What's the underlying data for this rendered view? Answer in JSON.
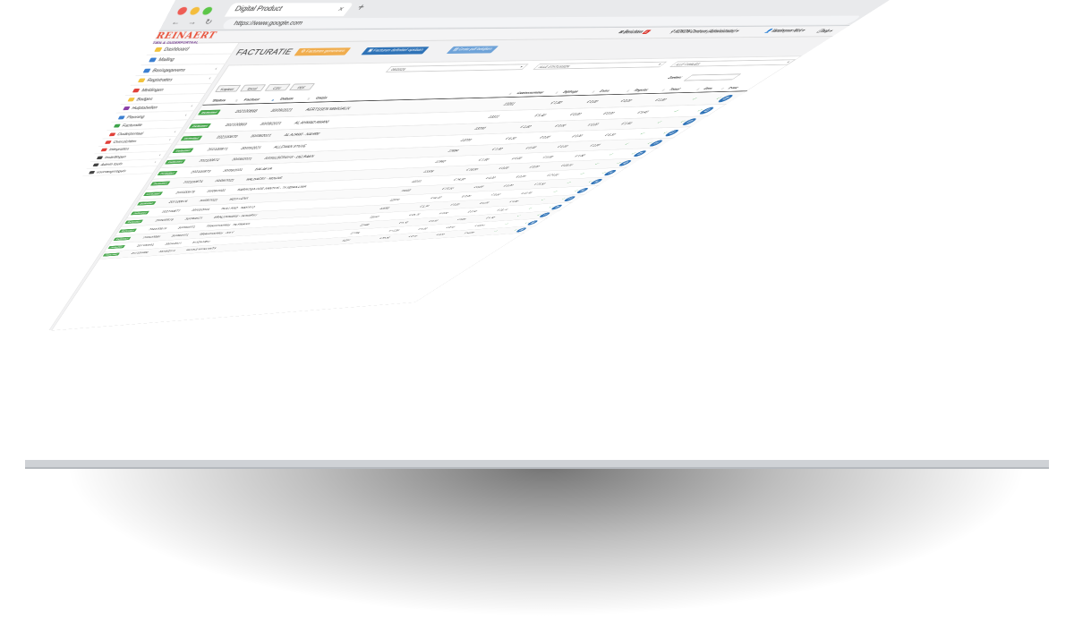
{
  "browser": {
    "tab_title": "Digital Product",
    "tab_close": "×",
    "new_tab": "+",
    "url": "https://www.google.com"
  },
  "logo": {
    "name": "REINAERT",
    "tagline": "TIEN & OUDERPORTAAL"
  },
  "topbar": {
    "messages_label": "Berichten",
    "messages_count": "0",
    "center_label": "KOKON-Centrum (Administrator) ▾",
    "user_label": "Vandevyver Nick ▾",
    "help_label": "help ▾"
  },
  "sidebar": {
    "items": [
      {
        "label": "Dashboard",
        "color": "#f2c33c",
        "chevron": ""
      },
      {
        "label": "Mailing",
        "color": "#3b7fd1",
        "chevron": ""
      },
      {
        "label": "Basisgegevens",
        "color": "#3b7fd1",
        "chevron": "‹"
      },
      {
        "label": "Registraties",
        "color": "#f2c33c",
        "chevron": "‹"
      },
      {
        "label": "Meldingen",
        "color": "#e0413a",
        "chevron": ""
      },
      {
        "label": "Badges",
        "color": "#f2c33c",
        "chevron": ""
      },
      {
        "label": "Hulptabellen",
        "color": "#8b3fa8",
        "chevron": "‹"
      },
      {
        "label": "Planning",
        "color": "#3b7fd1",
        "chevron": "‹"
      },
      {
        "label": "Facturatie",
        "color": "#3da34a",
        "chevron": ""
      },
      {
        "label": "Ouderportaal",
        "color": "#e0413a",
        "chevron": "‹"
      },
      {
        "label": "Overzichten",
        "color": "#e0413a",
        "chevron": "‹"
      },
      {
        "label": "Integraties",
        "color": "#e0413a",
        "chevron": ""
      },
      {
        "label": "Instellingen",
        "color": "#444444",
        "chevron": "‹"
      },
      {
        "label": "Admin tools",
        "color": "#444444",
        "chevron": "‹"
      },
      {
        "label": "voorrangsregels",
        "color": "#444444",
        "chevron": ""
      }
    ]
  },
  "page": {
    "title": "FACTURATIE",
    "btn_generate": "Facturen genereren",
    "btn_save": "Facturen definitief opslaan",
    "btn_pdf": "Grote pdf bekijken",
    "filter_period": "09/2025",
    "filter_status": "ALLE STATUSSEN",
    "filter_family": "ALLE FAMILIES",
    "export_buttons": [
      "Kopieer",
      "Excel",
      "CSV",
      "PDF"
    ],
    "search_label": "Zoeken:",
    "columns": [
      "Status",
      "Factuur",
      "Datum",
      "Gezin",
      "Gezinsnummer",
      "Bijdrage",
      "Extra",
      "Regular.",
      "Totaal",
      "Dom.",
      "E-Fac"
    ],
    "rows": [
      {
        "status": "Definitief",
        "factuur": "202100868",
        "datum": "30/09/2021",
        "gezin": "AERTSSEN MARGAUX",
        "nr": "13261",
        "bijdrage": "€ 1,80",
        "extra": "€ 0,00",
        "regular": "€ 0,00",
        "totaal": "€ 1,80"
      },
      {
        "status": "Definitief",
        "factuur": "202100869",
        "datum": "30/09/2021",
        "gezin": "AL AHMAD AMANI",
        "nr": "13311",
        "bijdrage": "€ 5,40",
        "extra": "€ 0,00",
        "regular": "€ 0,00",
        "totaal": "€ 5,40"
      },
      {
        "status": "Definitief",
        "factuur": "202100870",
        "datum": "30/09/2021",
        "gezin": "AL AZAWI - NAHRE",
        "nr": "13200",
        "bijdrage": "€ 1,80",
        "extra": "€ 0,00",
        "regular": "€ 0,00",
        "totaal": "€ 1,80"
      },
      {
        "status": "Definitief",
        "factuur": "202100871",
        "datum": "30/09/2021",
        "gezin": "ALLEMAN STEVE",
        "nr": "13299",
        "bijdrage": "€ 6,30",
        "extra": "€ 0,00",
        "regular": "€ 0,00",
        "totaal": "€ 6,30"
      },
      {
        "status": "Definitief",
        "factuur": "202100872",
        "datum": "30/09/2021",
        "gezin": "ASSELBERGHS - DELBAEN",
        "nr": "12884",
        "bijdrage": "€ 1,80",
        "extra": "€ 0,00",
        "regular": "€ 0,00",
        "totaal": "€ 1,80"
      },
      {
        "status": "Definitief",
        "factuur": "202100873",
        "datum": "30/09/2021",
        "gezin": "BALAEVA",
        "nr": "12860",
        "bijdrage": "€ 1,80",
        "extra": "€ 0,00",
        "regular": "€ 0,00",
        "totaal": "€ 1,80"
      },
      {
        "status": "Definitief",
        "factuur": "202100874",
        "datum": "30/09/2021",
        "gezin": "BALBAERT - MOENS",
        "nr": "13306",
        "bijdrage": "€ 18,00",
        "extra": "€ 0,00",
        "regular": "€ 0,00",
        "totaal": "€ 18,00"
      },
      {
        "status": "Definitief",
        "factuur": "202100875",
        "datum": "30/09/2021",
        "gezin": "BARBOSA DOS SANTOS - TEXEIRA LIMA",
        "nr": "13161",
        "bijdrage": "€ 24,30",
        "extra": "€ 0,00",
        "regular": "€ 0,00",
        "totaal": "€ 24,30"
      },
      {
        "status": "Definitief",
        "factuur": "202100876",
        "datum": "30/09/2021",
        "gezin": "BEULLENS",
        "nr": "13238",
        "bijdrage": "€ 15,30",
        "extra": "€ 0,00",
        "regular": "€ 0,00",
        "totaal": "€ 15,30"
      },
      {
        "status": "Definitief",
        "factuur": "202100877",
        "datum": "30/09/2021",
        "gezin": "BOLLAND - NAKATO",
        "nr": "12919",
        "bijdrage": "€ 11,40",
        "extra": "€ 0,00",
        "regular": "€ 0,00",
        "totaal": "€ 11,40"
      },
      {
        "status": "Definitief",
        "factuur": "202100878",
        "datum": "30/09/2021",
        "gezin": "BRAECKMANS - GOVAERT",
        "nr": "12698",
        "bijdrage": "€ 1,36",
        "extra": "€ 0,00",
        "regular": "€ 0,00",
        "totaal": "€ 1,36"
      },
      {
        "status": "Definitief",
        "factuur": "202100879",
        "datum": "30/09/2021",
        "gezin": "BRAECKMANS - HERMANS",
        "nr": "13068",
        "bijdrage": "€ 15,76",
        "extra": "€ 0,00",
        "regular": "€ 0,00",
        "totaal": "€ 15,76"
      },
      {
        "status": "Definitief",
        "factuur": "202100880",
        "datum": "30/09/2021",
        "gezin": "BRAECKMANS - JOLY",
        "nr": "11568",
        "bijdrage": "€ 5,40",
        "extra": "€ 0,00",
        "regular": "€ 0,00",
        "totaal": "€ 5,40"
      },
      {
        "status": "Definitief",
        "factuur": "202100881",
        "datum": "30/09/2021",
        "gezin": "BUGNARIU",
        "nr": "12794",
        "bijdrage": "€ 13,50",
        "extra": "€ 0,00",
        "regular": "€ 0,00",
        "totaal": "€ 13,50"
      },
      {
        "status": "Definitief",
        "factuur": "202100882",
        "datum": "30/09/2021",
        "gezin": "BUIJKS-WOLLANTS",
        "nr": "11202",
        "bijdrage": "€ 55,80",
        "extra": "€ 0,00",
        "regular": "€ 0,00",
        "totaal": "€ 55,80"
      }
    ]
  },
  "colors": {
    "btn_generate": "#f0ad4e",
    "btn_save": "#2f73b7",
    "btn_pdf": "#6fa3d8",
    "status_green": "#4aa84f",
    "check_green": "#3da34a",
    "pdf_blue": "#2f73b7"
  }
}
